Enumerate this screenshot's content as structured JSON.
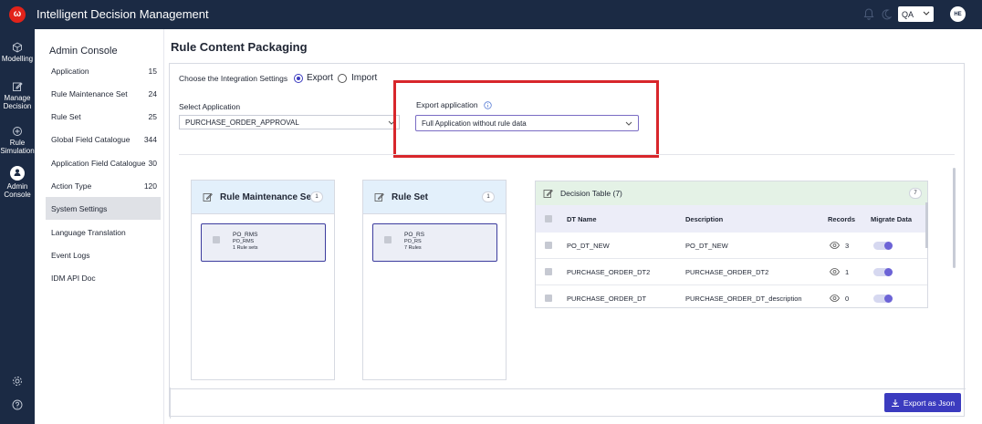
{
  "topbar": {
    "title": "Intelligent Decision Management",
    "logo_letter": "ω",
    "env": "QA",
    "avatar": "HE"
  },
  "rail": [
    {
      "label": "Modelling",
      "icon": "cube-icon"
    },
    {
      "label": "Manage Decision",
      "icon": "edit-icon"
    },
    {
      "label": "Rule Simulation",
      "icon": "simulation-icon"
    },
    {
      "label": "Admin Console",
      "icon": "admin-icon"
    }
  ],
  "sidebar": {
    "title": "Admin Console",
    "items": [
      {
        "label": "Application",
        "count": "15"
      },
      {
        "label": "Rule Maintenance Set",
        "count": "24"
      },
      {
        "label": "Rule Set",
        "count": "25"
      },
      {
        "label": "Global Field Catalogue",
        "count": "344"
      },
      {
        "label": "Application Field Catalogue",
        "count": "30"
      },
      {
        "label": "Action Type",
        "count": "120"
      },
      {
        "label": "System Settings",
        "count": ""
      },
      {
        "label": "Language Translation",
        "count": ""
      },
      {
        "label": "Event Logs",
        "count": ""
      },
      {
        "label": "IDM API Doc",
        "count": ""
      }
    ]
  },
  "page": {
    "title": "Rule Content Packaging",
    "integration_label": "Choose the Integration Settings",
    "export_label": "Export",
    "import_label": "Import",
    "select_app_label": "Select Application",
    "select_app_value": "PURCHASE_ORDER_APPROVAL",
    "export_app_label": "Export application",
    "export_app_value": "Full Application without rule data",
    "export_button": "Export as Json"
  },
  "rms_card": {
    "title": "Rule Maintenance Set",
    "count": "1",
    "item_name": "PO_RMS",
    "item_sub": "PO_RMS",
    "item_info": "1 Rule sets"
  },
  "rs_card": {
    "title": "Rule Set",
    "count": "1",
    "item_name": "PO_RS",
    "item_sub": "PO_RS",
    "item_info": "7 Rules"
  },
  "decision_table": {
    "title": "Decision Table (7)",
    "count": "7",
    "columns": [
      "DT Name",
      "Description",
      "Records",
      "Migrate Data"
    ],
    "rows": [
      {
        "name": "PO_DT_NEW",
        "description": "PO_DT_NEW",
        "records": "3"
      },
      {
        "name": "PURCHASE_ORDER_DT2",
        "description": "PURCHASE_ORDER_DT2",
        "records": "1"
      },
      {
        "name": "PURCHASE_ORDER_DT",
        "description": "PURCHASE_ORDER_DT_description",
        "records": "0"
      }
    ]
  },
  "colors": {
    "topbar": "#1b2a44",
    "accent": "#3b3bbf",
    "highlight_box": "#d8262b"
  }
}
